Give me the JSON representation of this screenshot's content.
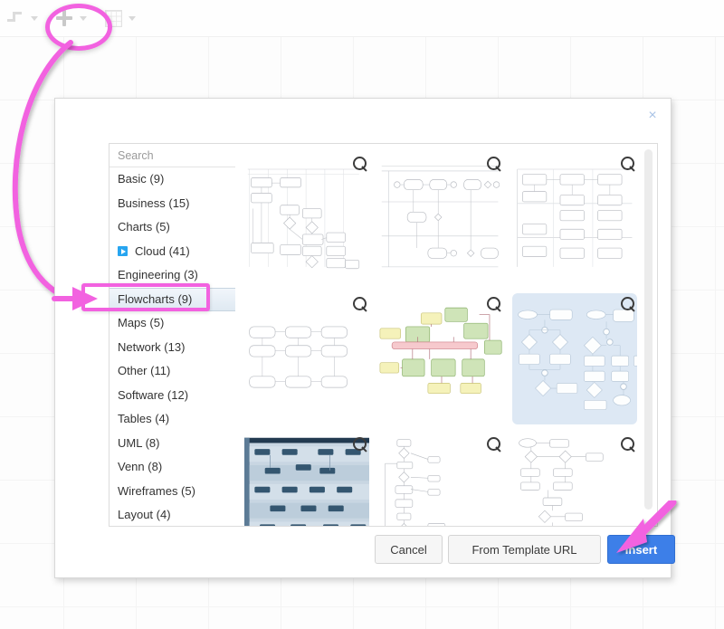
{
  "toolbar": {
    "connector_icon": "waypoint-connector-icon",
    "connector_caret": "chevron-down-icon",
    "insert_icon": "plus-icon",
    "insert_caret": "chevron-down-icon",
    "table_icon": "grid-table-icon",
    "table_caret": "chevron-down-icon"
  },
  "annotations": {
    "plus_ellipse_color": "#f262e0",
    "arrow_color": "#f262e0",
    "flowcharts_highlight_color": "#f262e0",
    "insert_arrow_color": "#f262e0"
  },
  "dialog": {
    "close_label": "×",
    "search": {
      "placeholder": "Search",
      "value": "",
      "icon": "search-icon"
    },
    "categories": [
      {
        "label": "Basic (9)",
        "selected": false,
        "expandable": false
      },
      {
        "label": "Business (15)",
        "selected": false,
        "expandable": false
      },
      {
        "label": "Charts (5)",
        "selected": false,
        "expandable": false
      },
      {
        "label": "Cloud (41)",
        "selected": false,
        "expandable": true
      },
      {
        "label": "Engineering (3)",
        "selected": false,
        "expandable": false
      },
      {
        "label": "Flowcharts (9)",
        "selected": true,
        "expandable": false
      },
      {
        "label": "Maps (5)",
        "selected": false,
        "expandable": false
      },
      {
        "label": "Network (13)",
        "selected": false,
        "expandable": false
      },
      {
        "label": "Other (11)",
        "selected": false,
        "expandable": false
      },
      {
        "label": "Software (12)",
        "selected": false,
        "expandable": false
      },
      {
        "label": "Tables (4)",
        "selected": false,
        "expandable": false
      },
      {
        "label": "UML (8)",
        "selected": false,
        "expandable": false
      },
      {
        "label": "Venn (8)",
        "selected": false,
        "expandable": false
      },
      {
        "label": "Wireframes (5)",
        "selected": false,
        "expandable": false
      },
      {
        "label": "Layout (4)",
        "selected": false,
        "expandable": false
      }
    ],
    "templates": [
      {
        "name": "swimlane-flowchart-grid",
        "style": "swimlane",
        "selected": false,
        "zoom_icon": "magnifier-icon"
      },
      {
        "name": "cross-functional-process",
        "style": "crossfunc",
        "selected": false,
        "zoom_icon": "magnifier-icon"
      },
      {
        "name": "vertical-swimlane-process",
        "style": "vswim",
        "selected": false,
        "zoom_icon": "magnifier-icon"
      },
      {
        "name": "horizontal-flow-diagram",
        "style": "hflow",
        "selected": false,
        "zoom_icon": "magnifier-icon"
      },
      {
        "name": "colored-data-flow-diagram",
        "style": "colored",
        "selected": false,
        "zoom_icon": "magnifier-icon"
      },
      {
        "name": "decision-flowchart",
        "style": "decision",
        "selected": true,
        "zoom_icon": "magnifier-icon"
      },
      {
        "name": "dark-swimlane-matrix",
        "style": "dark",
        "selected": false,
        "zoom_icon": "magnifier-icon"
      },
      {
        "name": "vertical-process-chart",
        "style": "vproc",
        "selected": false,
        "zoom_icon": "magnifier-icon"
      },
      {
        "name": "branching-flowchart",
        "style": "branch",
        "selected": false,
        "zoom_icon": "magnifier-icon"
      }
    ],
    "scrollbar": {
      "name": "templates-scrollbar"
    },
    "footer": {
      "cancel_label": "Cancel",
      "template_url_label": "From Template URL",
      "insert_label": "Insert",
      "insert_color": "#3d7fe8"
    }
  }
}
